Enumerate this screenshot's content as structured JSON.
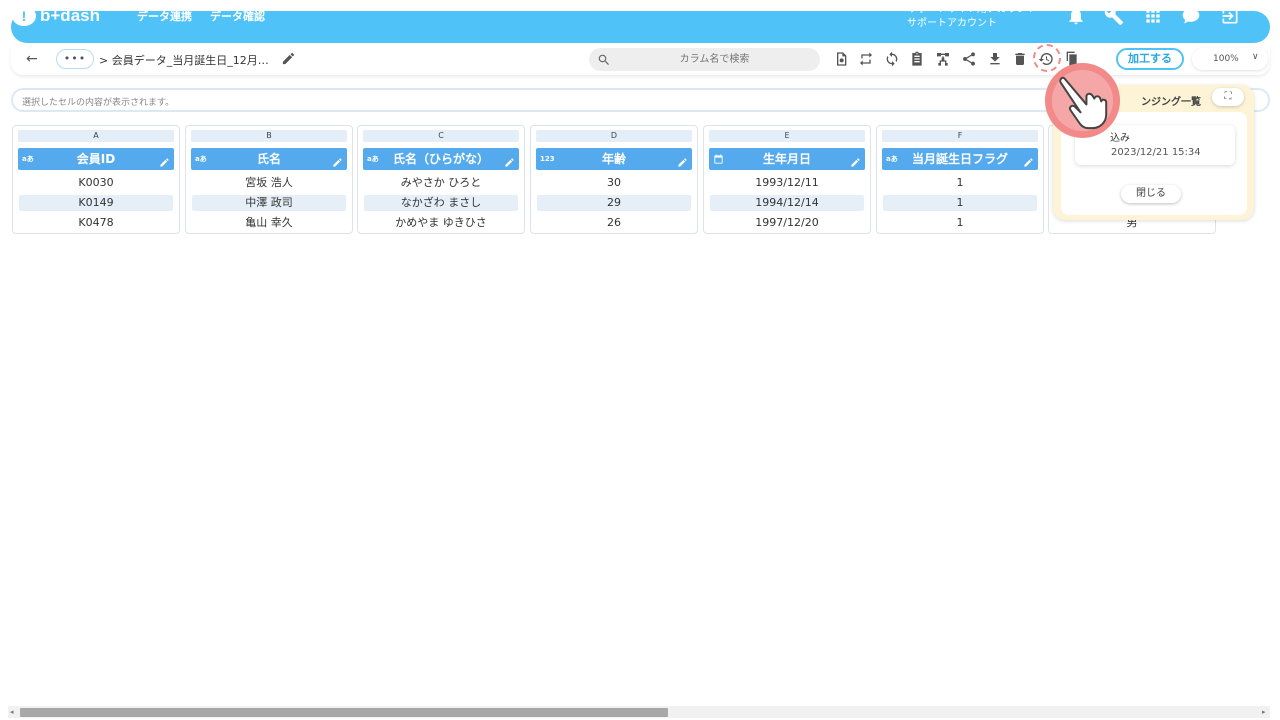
{
  "header": {
    "logo_text": "b+dash",
    "nav": [
      "データ連携",
      "データ確認"
    ],
    "account_line1": "サポートサイト用アカウント",
    "account_line2": "サポートアカウント"
  },
  "toolbar": {
    "more_label": "•••",
    "breadcrumb": "> 会員データ_当月誕生日_12月…",
    "search_placeholder": "カラム名で検索",
    "process_label": "加工する",
    "zoom_value": "100%"
  },
  "cellbar": {
    "placeholder": "選択したセルの内容が表示されます。"
  },
  "columns": [
    {
      "letter": "A",
      "name": "会員ID",
      "type": "aあ",
      "values": [
        "K0030",
        "K0149",
        "K0478"
      ]
    },
    {
      "letter": "B",
      "name": "氏名",
      "type": "aあ",
      "values": [
        "宮坂 浩人",
        "中澤 政司",
        "亀山 幸久"
      ]
    },
    {
      "letter": "C",
      "name": "氏名（ひらがな）",
      "type": "aあ",
      "values": [
        "みやさか ひろと",
        "なかざわ まさし",
        "かめやま ゆきひさ"
      ]
    },
    {
      "letter": "D",
      "name": "年齢",
      "type": "123",
      "values": [
        "30",
        "29",
        "26"
      ]
    },
    {
      "letter": "E",
      "name": "生年月日",
      "type": "calendar",
      "values": [
        "1993/12/11",
        "1994/12/14",
        "1997/12/20"
      ]
    },
    {
      "letter": "F",
      "name": "当月誕生日フラグ",
      "type": "aあ",
      "values": [
        "1",
        "1",
        "1"
      ]
    },
    {
      "letter": "",
      "name": "",
      "type": "",
      "values": [
        "",
        "",
        "男"
      ]
    }
  ],
  "popup": {
    "title": "ンジング一覧",
    "expand_label": "⛶",
    "item_name": "込み",
    "item_time": "2023/12/21 15:34",
    "close_label": "閉じる"
  },
  "colors": {
    "header_bg": "#4fc3f7",
    "column_head": "#55aaee",
    "popup_bg": "#fdf3d6",
    "pointer": "#f28a8a"
  }
}
